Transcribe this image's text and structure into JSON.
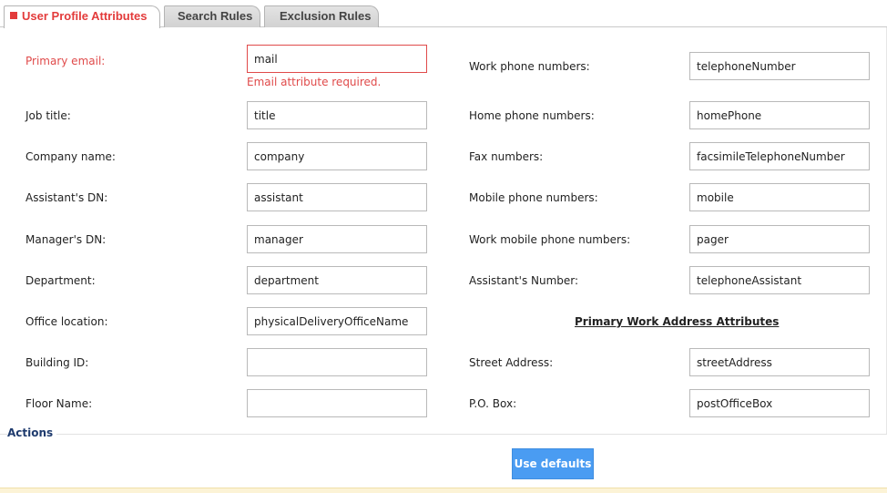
{
  "tabs": [
    {
      "label": "User Profile Attributes",
      "active": true
    },
    {
      "label": "Search Rules",
      "active": false
    },
    {
      "label": "Exclusion Rules",
      "active": false
    }
  ],
  "form": {
    "left": [
      {
        "label": "Primary email:",
        "value": "mail",
        "error": true
      },
      {
        "label": "Job title:",
        "value": "title"
      },
      {
        "label": "Company name:",
        "value": "company"
      },
      {
        "label": "Assistant's DN:",
        "value": "assistant"
      },
      {
        "label": "Manager's DN:",
        "value": "manager"
      },
      {
        "label": "Department:",
        "value": "department"
      },
      {
        "label": "Office location:",
        "value": "physicalDeliveryOfficeName"
      },
      {
        "label": "Building ID:",
        "value": ""
      },
      {
        "label": "Floor Name:",
        "value": ""
      }
    ],
    "right": [
      {
        "label": "Work phone numbers:",
        "value": "telephoneNumber"
      },
      {
        "label": "Home phone numbers:",
        "value": "homePhone"
      },
      {
        "label": "Fax numbers:",
        "value": "facsimileTelephoneNumber"
      },
      {
        "label": "Mobile phone numbers:",
        "value": "mobile"
      },
      {
        "label": "Work mobile phone numbers:",
        "value": "pager"
      },
      {
        "label": "Assistant's Number:",
        "value": "telephoneAssistant"
      },
      {
        "label": "Street Address:",
        "value": "streetAddress"
      },
      {
        "label": "P.O. Box:",
        "value": "postOfficeBox"
      }
    ],
    "email_error": "Email attribute required.",
    "address_section_title": "Primary Work Address Attributes"
  },
  "actions": {
    "label": "Actions",
    "use_defaults_label": "Use defaults"
  },
  "colors": {
    "error": "#e04a4a",
    "button": "#4a9cf2",
    "actions_label": "#1f3b6e"
  }
}
